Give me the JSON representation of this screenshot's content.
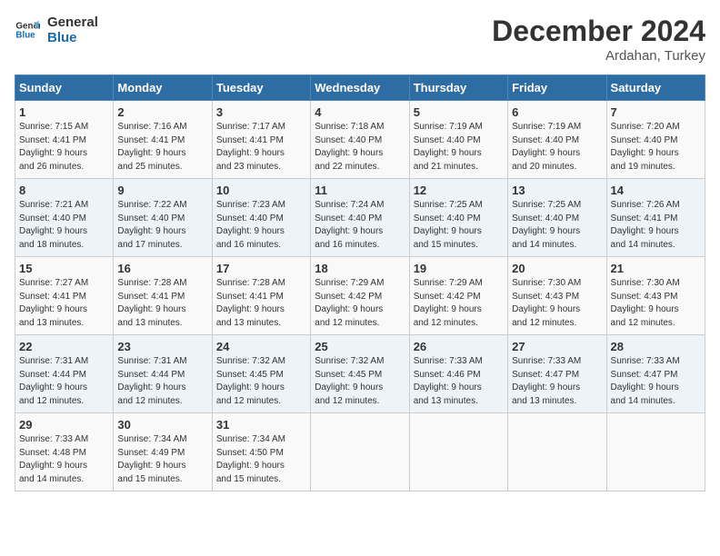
{
  "header": {
    "logo_line1": "General",
    "logo_line2": "Blue",
    "month": "December 2024",
    "location": "Ardahan, Turkey"
  },
  "days_of_week": [
    "Sunday",
    "Monday",
    "Tuesday",
    "Wednesday",
    "Thursday",
    "Friday",
    "Saturday"
  ],
  "weeks": [
    [
      {
        "day": "1",
        "info": "Sunrise: 7:15 AM\nSunset: 4:41 PM\nDaylight: 9 hours\nand 26 minutes."
      },
      {
        "day": "2",
        "info": "Sunrise: 7:16 AM\nSunset: 4:41 PM\nDaylight: 9 hours\nand 25 minutes."
      },
      {
        "day": "3",
        "info": "Sunrise: 7:17 AM\nSunset: 4:41 PM\nDaylight: 9 hours\nand 23 minutes."
      },
      {
        "day": "4",
        "info": "Sunrise: 7:18 AM\nSunset: 4:40 PM\nDaylight: 9 hours\nand 22 minutes."
      },
      {
        "day": "5",
        "info": "Sunrise: 7:19 AM\nSunset: 4:40 PM\nDaylight: 9 hours\nand 21 minutes."
      },
      {
        "day": "6",
        "info": "Sunrise: 7:19 AM\nSunset: 4:40 PM\nDaylight: 9 hours\nand 20 minutes."
      },
      {
        "day": "7",
        "info": "Sunrise: 7:20 AM\nSunset: 4:40 PM\nDaylight: 9 hours\nand 19 minutes."
      }
    ],
    [
      {
        "day": "8",
        "info": "Sunrise: 7:21 AM\nSunset: 4:40 PM\nDaylight: 9 hours\nand 18 minutes."
      },
      {
        "day": "9",
        "info": "Sunrise: 7:22 AM\nSunset: 4:40 PM\nDaylight: 9 hours\nand 17 minutes."
      },
      {
        "day": "10",
        "info": "Sunrise: 7:23 AM\nSunset: 4:40 PM\nDaylight: 9 hours\nand 16 minutes."
      },
      {
        "day": "11",
        "info": "Sunrise: 7:24 AM\nSunset: 4:40 PM\nDaylight: 9 hours\nand 16 minutes."
      },
      {
        "day": "12",
        "info": "Sunrise: 7:25 AM\nSunset: 4:40 PM\nDaylight: 9 hours\nand 15 minutes."
      },
      {
        "day": "13",
        "info": "Sunrise: 7:25 AM\nSunset: 4:40 PM\nDaylight: 9 hours\nand 14 minutes."
      },
      {
        "day": "14",
        "info": "Sunrise: 7:26 AM\nSunset: 4:41 PM\nDaylight: 9 hours\nand 14 minutes."
      }
    ],
    [
      {
        "day": "15",
        "info": "Sunrise: 7:27 AM\nSunset: 4:41 PM\nDaylight: 9 hours\nand 13 minutes."
      },
      {
        "day": "16",
        "info": "Sunrise: 7:28 AM\nSunset: 4:41 PM\nDaylight: 9 hours\nand 13 minutes."
      },
      {
        "day": "17",
        "info": "Sunrise: 7:28 AM\nSunset: 4:41 PM\nDaylight: 9 hours\nand 13 minutes."
      },
      {
        "day": "18",
        "info": "Sunrise: 7:29 AM\nSunset: 4:42 PM\nDaylight: 9 hours\nand 12 minutes."
      },
      {
        "day": "19",
        "info": "Sunrise: 7:29 AM\nSunset: 4:42 PM\nDaylight: 9 hours\nand 12 minutes."
      },
      {
        "day": "20",
        "info": "Sunrise: 7:30 AM\nSunset: 4:43 PM\nDaylight: 9 hours\nand 12 minutes."
      },
      {
        "day": "21",
        "info": "Sunrise: 7:30 AM\nSunset: 4:43 PM\nDaylight: 9 hours\nand 12 minutes."
      }
    ],
    [
      {
        "day": "22",
        "info": "Sunrise: 7:31 AM\nSunset: 4:44 PM\nDaylight: 9 hours\nand 12 minutes."
      },
      {
        "day": "23",
        "info": "Sunrise: 7:31 AM\nSunset: 4:44 PM\nDaylight: 9 hours\nand 12 minutes."
      },
      {
        "day": "24",
        "info": "Sunrise: 7:32 AM\nSunset: 4:45 PM\nDaylight: 9 hours\nand 12 minutes."
      },
      {
        "day": "25",
        "info": "Sunrise: 7:32 AM\nSunset: 4:45 PM\nDaylight: 9 hours\nand 12 minutes."
      },
      {
        "day": "26",
        "info": "Sunrise: 7:33 AM\nSunset: 4:46 PM\nDaylight: 9 hours\nand 13 minutes."
      },
      {
        "day": "27",
        "info": "Sunrise: 7:33 AM\nSunset: 4:47 PM\nDaylight: 9 hours\nand 13 minutes."
      },
      {
        "day": "28",
        "info": "Sunrise: 7:33 AM\nSunset: 4:47 PM\nDaylight: 9 hours\nand 14 minutes."
      }
    ],
    [
      {
        "day": "29",
        "info": "Sunrise: 7:33 AM\nSunset: 4:48 PM\nDaylight: 9 hours\nand 14 minutes."
      },
      {
        "day": "30",
        "info": "Sunrise: 7:34 AM\nSunset: 4:49 PM\nDaylight: 9 hours\nand 15 minutes."
      },
      {
        "day": "31",
        "info": "Sunrise: 7:34 AM\nSunset: 4:50 PM\nDaylight: 9 hours\nand 15 minutes."
      },
      {
        "day": "",
        "info": ""
      },
      {
        "day": "",
        "info": ""
      },
      {
        "day": "",
        "info": ""
      },
      {
        "day": "",
        "info": ""
      }
    ]
  ]
}
